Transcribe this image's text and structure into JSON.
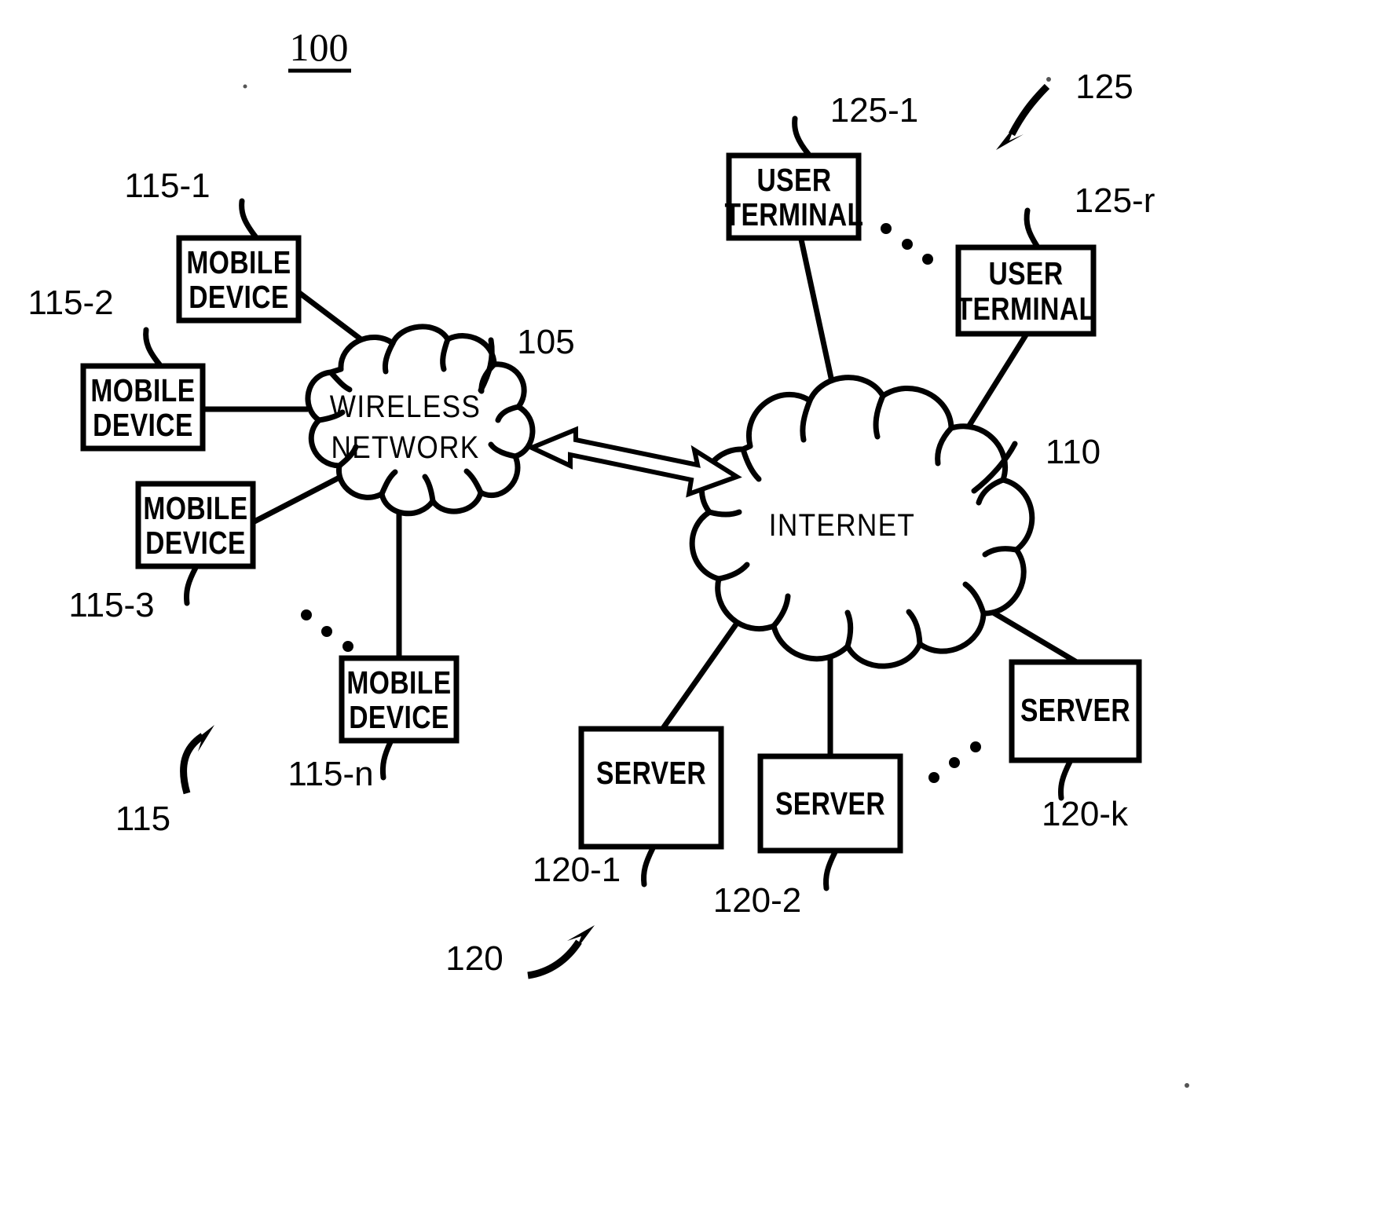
{
  "figure": {
    "title": "100",
    "title_underlined": true,
    "type": "patent-network-diagram",
    "background_color": "#ffffff",
    "line_color": "#000000"
  },
  "clouds": [
    {
      "id": "wireless-network",
      "label_line1": "WIRELESS",
      "label_line2": "NETWORK",
      "ref": "105"
    },
    {
      "id": "internet",
      "label_line1": "INTERNET",
      "label_line2": "",
      "ref": "110"
    }
  ],
  "mobile_devices": {
    "group_ref": "115",
    "items": [
      {
        "label_line1": "MOBILE",
        "label_line2": "DEVICE",
        "ref": "115-1"
      },
      {
        "label_line1": "MOBILE",
        "label_line2": "DEVICE",
        "ref": "115-2"
      },
      {
        "label_line1": "MOBILE",
        "label_line2": "DEVICE",
        "ref": "115-3"
      },
      {
        "label_line1": "MOBILE",
        "label_line2": "DEVICE",
        "ref": "115-n"
      }
    ]
  },
  "servers": {
    "group_ref": "120",
    "items": [
      {
        "label": "SERVER",
        "ref": "120-1"
      },
      {
        "label": "SERVER",
        "ref": "120-2"
      },
      {
        "label": "SERVER",
        "ref": "120-k"
      }
    ]
  },
  "user_terminals": {
    "group_ref": "125",
    "items": [
      {
        "label_line1": "USER",
        "label_line2": "TERMINAL",
        "ref": "125-1"
      },
      {
        "label_line1": "USER",
        "label_line2": "TERMINAL",
        "ref": "125-r"
      }
    ]
  },
  "connections": {
    "wireless_to_internet": "bidirectional-open-arrow"
  }
}
